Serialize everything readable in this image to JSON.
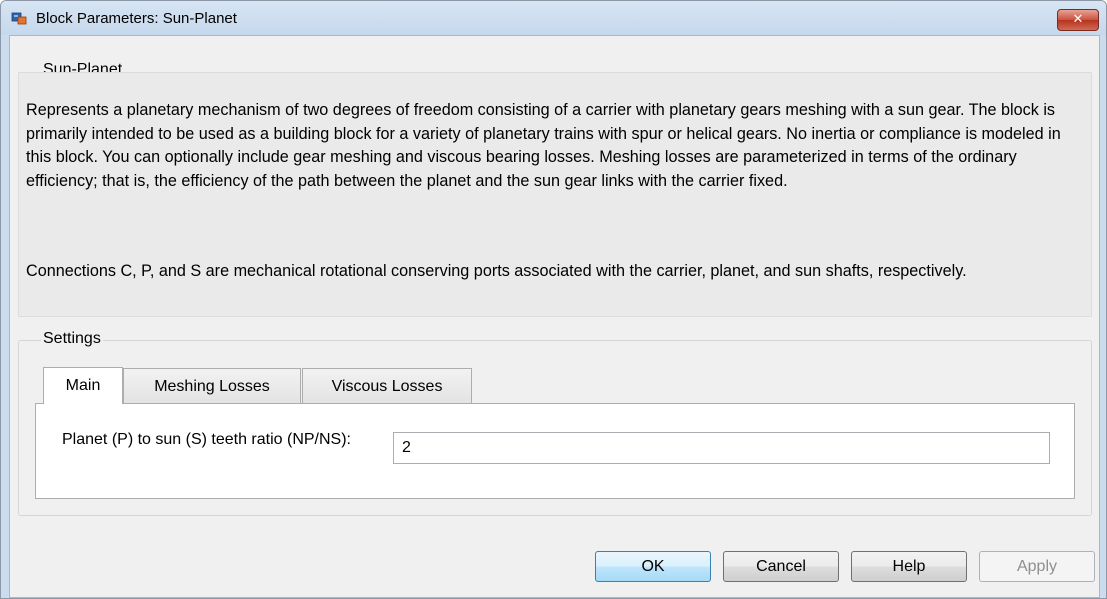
{
  "window": {
    "title": "Block Parameters: Sun-Planet",
    "close_symbol": "✕",
    "close_icon": "close-icon",
    "app_icon": "simulink-block-icon"
  },
  "description_group": {
    "label": "Sun-Planet",
    "paragraph1": "Represents a planetary mechanism of two degrees of freedom consisting of a carrier with planetary gears meshing with a sun gear. The block is primarily intended to be used as a building block for a variety of planetary trains with spur or helical gears. No inertia or compliance is modeled in this block. You can optionally include gear meshing and viscous bearing losses. Meshing losses are parameterized in terms of the ordinary efficiency; that is, the efficiency of the path between the planet and the sun gear links with the carrier fixed.",
    "paragraph2": "Connections C, P, and S are mechanical rotational conserving ports associated with the carrier, planet, and sun shafts, respectively."
  },
  "settings": {
    "label": "Settings",
    "tabs": [
      {
        "label": "Main",
        "active": true
      },
      {
        "label": "Meshing Losses",
        "active": false
      },
      {
        "label": "Viscous Losses",
        "active": false
      }
    ],
    "parameters": [
      {
        "label": "Planet (P) to sun (S) teeth ratio (NP/NS):",
        "value": "2"
      }
    ]
  },
  "buttons": {
    "ok": "OK",
    "cancel": "Cancel",
    "help": "Help",
    "apply": "Apply"
  },
  "colors": {
    "title_bar": "#cbdcef",
    "close_button": "#c7523f",
    "dialog_background": "#f0f0f0",
    "default_button": "#bee6fd"
  }
}
